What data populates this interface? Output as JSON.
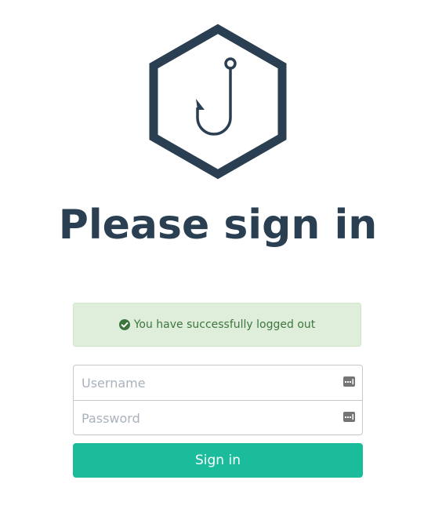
{
  "brand": {
    "logo_icon": "fishing-hook-hexagon-icon",
    "color": "#2a3f52"
  },
  "heading": {
    "title": "Please sign in"
  },
  "alert": {
    "icon": "check-circle-icon",
    "message": "You have successfully logged out",
    "background": "#dfeedb",
    "text_color": "#3c763d"
  },
  "form": {
    "username": {
      "placeholder": "Username",
      "value": "",
      "icon": "keyboard-icon"
    },
    "password": {
      "placeholder": "Password",
      "value": "",
      "icon": "keyboard-icon"
    },
    "submit_label": "Sign in",
    "submit_color": "#1abc9c"
  }
}
